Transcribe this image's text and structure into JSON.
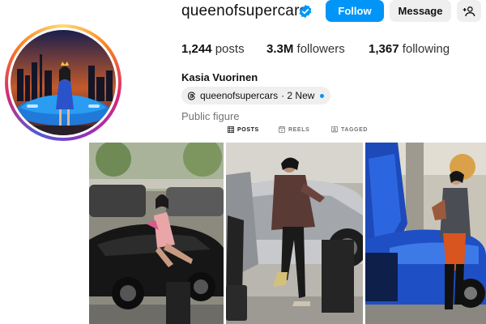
{
  "profile": {
    "username": "queenofsupercars",
    "full_name": "Kasia Vuorinen",
    "category": "Public figure",
    "threads_handle": "queenofsupercars",
    "threads_new": "· 2 New"
  },
  "actions": {
    "follow_label": "Follow",
    "message_label": "Message"
  },
  "stats": {
    "posts_count": "1,244",
    "posts_label": "posts",
    "followers_count": "3.3M",
    "followers_label": "followers",
    "following_count": "1,367",
    "following_label": "following"
  },
  "tabs": [
    {
      "label": "POSTS",
      "icon": "grid-icon",
      "active": true
    },
    {
      "label": "REELS",
      "icon": "reels-icon",
      "active": false
    },
    {
      "label": "TAGGED",
      "icon": "tagged-icon",
      "active": false
    }
  ],
  "colors": {
    "follow_blue": "#0095f6",
    "verified_blue": "#0095f6",
    "secondary_button": "#efefef",
    "muted_text": "#737373"
  },
  "posts": [
    {
      "description": "woman posing on black supercar in parking area"
    },
    {
      "description": "woman in leather jacket beside silver supercar with open door"
    },
    {
      "description": "woman seated by blue supercar with scissor doors"
    }
  ]
}
